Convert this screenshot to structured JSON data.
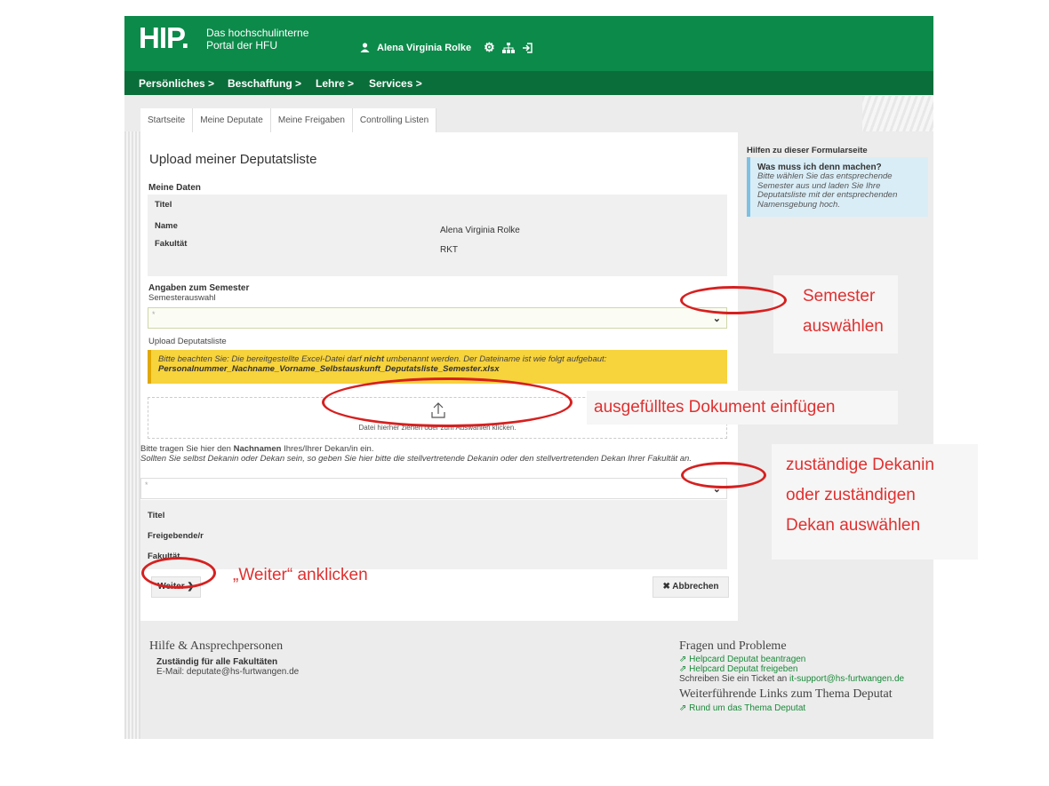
{
  "header": {
    "logo": "HIP.",
    "subtitle_line1": "Das hochschulinterne",
    "subtitle_line2": "Portal der HFU",
    "user_name": "Alena Virginia Rolke",
    "icons": [
      "user-icon",
      "gear-icon",
      "sitemap-icon",
      "logout-icon"
    ]
  },
  "nav": {
    "items": [
      "Persönliches >",
      "Beschaffung >",
      "Lehre >",
      "Services >"
    ]
  },
  "tabs": [
    "Startseite",
    "Meine Deputate",
    "Meine Freigaben",
    "Controlling Listen"
  ],
  "page": {
    "title": "Upload meiner Deputatsliste",
    "meine_daten": "Meine Daten",
    "fields": [
      {
        "label": "Titel",
        "value": ""
      },
      {
        "label": "Name",
        "value": "Alena Virginia Rolke"
      },
      {
        "label": "Fakultät",
        "value": "RKT"
      }
    ],
    "semester_heading": "Angaben zum Semester",
    "semester_label": "Semesterauswahl",
    "semester_selected": "*",
    "upload_label": "Upload Deputatsliste",
    "notice_pre": "Bitte beachten Sie: Die bereitgestellte Excel-Datei darf ",
    "notice_bold": "nicht",
    "notice_post": " umbenannt werden. Der Dateiname ist wie folgt aufgebaut:",
    "notice_filename": "Personalnummer_Nachname_Vorname_Selbstauskunft_Deputatsliste_Semester.xlsx",
    "dropzone_text": "Datei hierher ziehen oder zum Auswählen klicken.",
    "dekan_pre": "Bitte tragen Sie hier den ",
    "dekan_bold": "Nachnamen",
    "dekan_post": " Ihres/Ihrer Dekan/in ein.",
    "dekan_note": "Sollten Sie selbst Dekanin oder Dekan sein, so geben Sie hier bitte die stellvertretende Dekanin oder den stellvertretenden Dekan Ihrer Fakultät an.",
    "dekan_selected": "*",
    "dekan_fields": [
      "Titel",
      "Freigebende/r",
      "Fakultät"
    ],
    "weiter_label": "Weiter",
    "abbrechen_label": "Abbrechen"
  },
  "help": {
    "title": "Hilfen zu dieser Formularseite",
    "question": "Was muss ich denn machen?",
    "answer": "Bitte wählen Sie das entsprechende Semester aus und laden Sie Ihre Deputatsliste mit der entsprechenden Namensgebung hoch."
  },
  "footer": {
    "left_heading": "Hilfe & Ansprechpersonen",
    "left_bold": "Zuständig für alle Fakultäten",
    "left_email": "E-Mail: deputate@hs-furtwangen.de",
    "right_heading": "Fragen und Probleme",
    "link1": "Helpcard Deputat beantragen",
    "link2": "Helpcard Deputat freigeben",
    "ticket_pre": "Schreiben Sie ein Ticket an ",
    "ticket_email": "it-support@hs-furtwangen.de",
    "links_heading": "Weiterführende Links zum Thema Deputat",
    "link3": "Rund um das Thema Deputat"
  },
  "annotations": {
    "semester_l1": "Semester",
    "semester_l2": "auswählen",
    "dokument": "ausgefülltes Dokument einfügen",
    "dekan_l1": "zuständige Dekanin",
    "dekan_l2": "oder zuständigen",
    "dekan_l3": "Dekan auswählen",
    "weiter": "„Weiter“ anklicken"
  },
  "colors": {
    "header_green": "#0c8a4a",
    "nav_green": "#0a6e3a",
    "notice_yellow": "#f7d33c",
    "annotation_red": "#e03030",
    "link_green": "#1a8a3a"
  }
}
